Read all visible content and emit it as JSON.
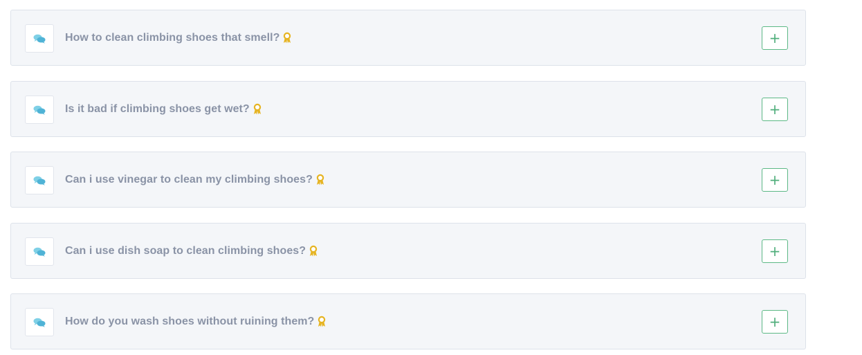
{
  "faq": {
    "items": [
      {
        "question": "How to clean climbing shoes that smell?",
        "toggle": "+"
      },
      {
        "question": "Is it bad if climbing shoes get wet?",
        "toggle": "+"
      },
      {
        "question": "Can i use vinegar to clean my climbing shoes?",
        "toggle": "+"
      },
      {
        "question": "Can i use dish soap to clean climbing shoes?",
        "toggle": "+"
      },
      {
        "question": "How do you wash shoes without ruining them?",
        "toggle": "+"
      }
    ]
  },
  "icons": {
    "chat": "chat-bubbles-icon",
    "award": "award-ribbon-icon",
    "toggle": "plus-icon"
  },
  "colors": {
    "card_background": "#f4f6f9",
    "card_border": "#dde2ea",
    "question_text": "#8a93a6",
    "chat_icon": "#5bc0de",
    "award_icon": "#e6b422",
    "toggle_accent": "#5cb885"
  }
}
